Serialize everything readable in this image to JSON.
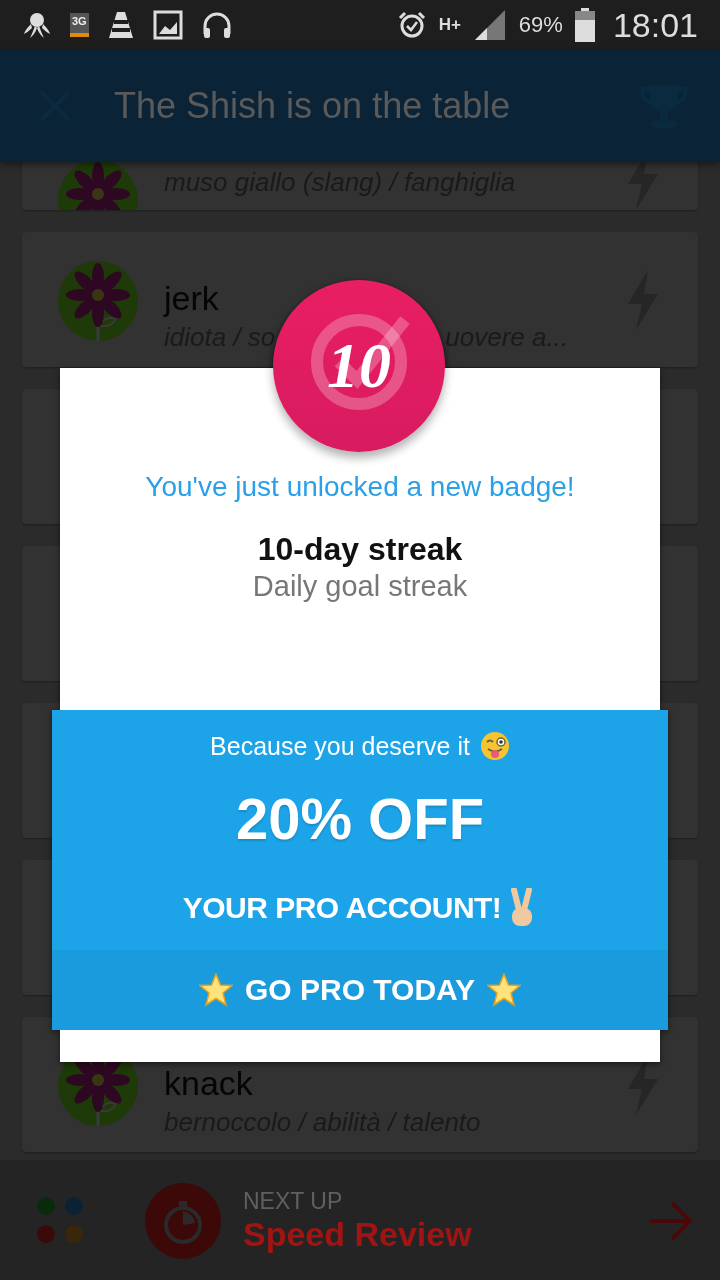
{
  "status_bar": {
    "network_badge": "3G",
    "network_type": "H+",
    "battery": "69%",
    "time": "18:01"
  },
  "app_bar": {
    "title": "The Shish is on the table"
  },
  "cards": [
    {
      "kind": "word",
      "subtitle_parts": [
        "muso giallo (slang) / fanghiglia"
      ]
    },
    {
      "kind": "word",
      "title": "jerk",
      "subtitle_parts": [
        "idiota / so",
        "uovere a..."
      ]
    },
    {
      "kind": "covered"
    },
    {
      "kind": "covered"
    },
    {
      "kind": "covered"
    },
    {
      "kind": "covered"
    },
    {
      "kind": "word",
      "title": "knack",
      "subtitle_parts": [
        "bernoccolo / abilità / talento"
      ]
    }
  ],
  "dialog": {
    "badge_number": "10",
    "heading": "You've just unlocked a new badge!",
    "badge_title": "10-day streak",
    "badge_subtitle": "Daily goal streak",
    "promo": {
      "line1": "Because you deserve it",
      "headline": "20% OFF",
      "line2": "YOUR PRO ACCOUNT!",
      "button": "GO PRO TODAY"
    }
  },
  "bottom_bar": {
    "label": "NEXT UP",
    "title": "Speed Review"
  }
}
